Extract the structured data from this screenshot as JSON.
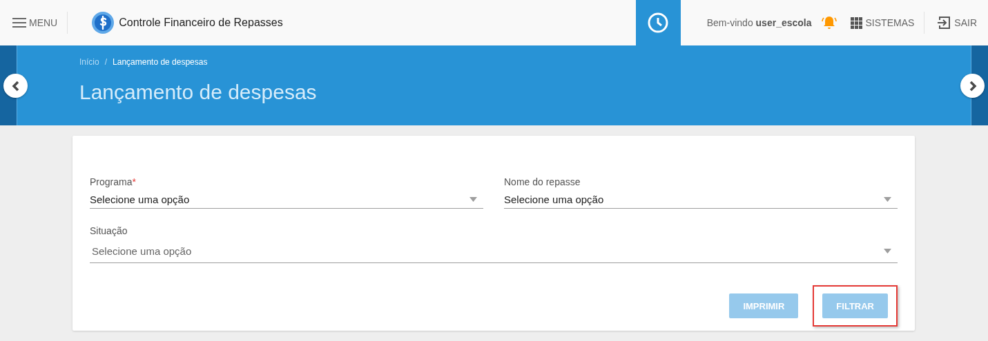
{
  "header": {
    "menu_label": "MENU",
    "app_title": "Controle Financeiro de Repasses",
    "welcome": "Bem-vindo",
    "username": "user_escola",
    "systems_label": "SISTEMAS",
    "logout_label": "SAIR"
  },
  "breadcrumb_separator": "/",
  "breadcrumb": [
    {
      "label": "Início",
      "current": false
    },
    {
      "label": "Lançamento de despesas",
      "current": true
    }
  ],
  "page_title": "Lançamento de despesas",
  "fields": [
    {
      "label": "Programa",
      "required_mark": "*",
      "value": "Selecione uma opção"
    },
    {
      "label": "Nome do repasse",
      "value": "Selecione uma opção"
    },
    {
      "label": "Situação",
      "placeholder": "Selecione uma opção"
    }
  ],
  "buttons": [
    {
      "label": "IMPRIMIR",
      "disabled": true,
      "highlighted": false
    },
    {
      "label": "FILTRAR",
      "disabled": true,
      "highlighted": true
    }
  ]
}
